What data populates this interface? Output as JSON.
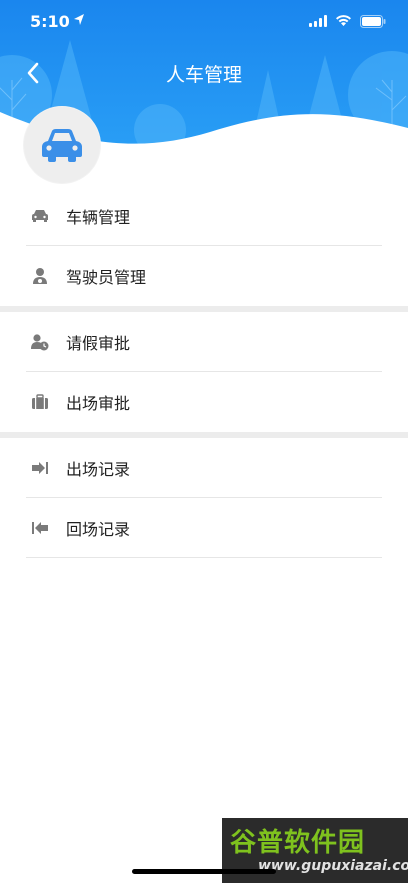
{
  "status_bar": {
    "time": "5:10"
  },
  "nav": {
    "title": "人车管理"
  },
  "menu": {
    "group1": [
      {
        "label": "车辆管理",
        "icon": "car-icon"
      },
      {
        "label": "驾驶员管理",
        "icon": "driver-icon"
      }
    ],
    "group2": [
      {
        "label": "请假审批",
        "icon": "leave-approval-icon"
      },
      {
        "label": "出场审批",
        "icon": "briefcase-icon"
      }
    ],
    "group3": [
      {
        "label": "出场记录",
        "icon": "exit-icon"
      },
      {
        "label": "回场记录",
        "icon": "return-icon"
      }
    ]
  },
  "watermark": {
    "title": "谷普软件园",
    "url": "www.gupuxiazai.com"
  },
  "colors": {
    "header_blue": "#1e90f0",
    "header_blue_dark": "#1478d8",
    "avatar_car": "#3b8fe8",
    "icon_gray": "#7a7a7a"
  }
}
